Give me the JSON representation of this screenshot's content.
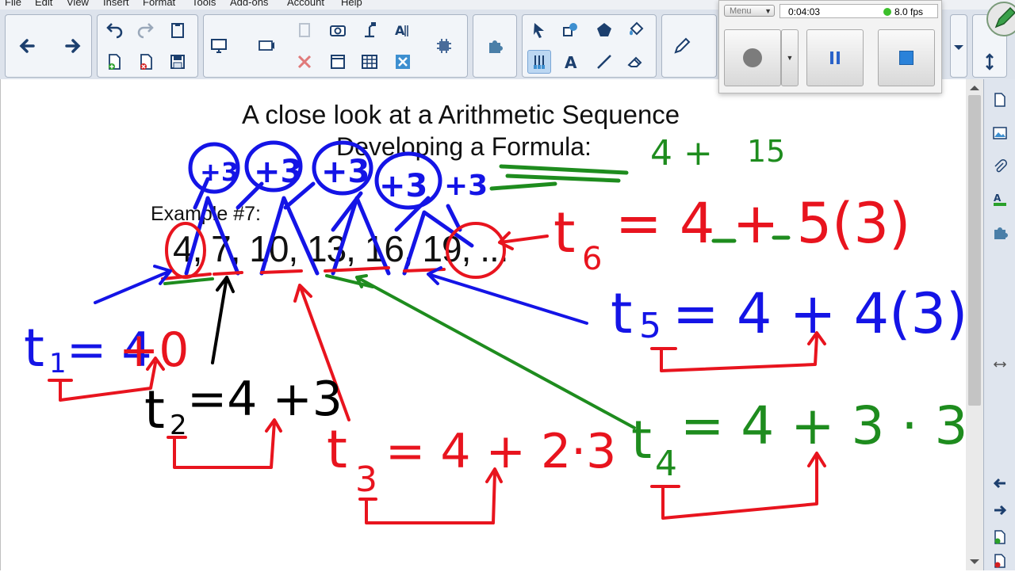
{
  "menubar": {
    "items": [
      "File",
      "Edit",
      "View",
      "Insert",
      "Format",
      "Tools",
      "Add-ons",
      "Account",
      "Help"
    ]
  },
  "toolbar": {
    "icons": [
      "back-arrow-icon",
      "forward-arrow-icon",
      "undo-icon",
      "redo-icon",
      "paste-icon",
      "new-page-icon",
      "delete-page-icon",
      "save-icon",
      "screen-display-icon",
      "screen-shade-icon",
      "clipboard-icon",
      "delete-icon",
      "camera-icon",
      "page-screen-icon",
      "document-camera-icon",
      "table-icon",
      "spell-icon",
      "clear-icon",
      "hardware-icon",
      "add-on-icon",
      "select-arrow-icon",
      "shapes-icon",
      "polygon-icon",
      "fill-icon",
      "pen-tool-icon",
      "text-icon",
      "line-icon",
      "eraser-icon",
      "pen-icon"
    ]
  },
  "recorder": {
    "menu_label": "Menu",
    "elapsed_time": "0:04:03",
    "fps": "8.0 fps",
    "status_color": "#3bbf2a"
  },
  "board": {
    "title_line1": "A close look at a Arithmetic Sequence",
    "title_line2": "Developing a Formula:",
    "example_label": "Example #7:",
    "sequence": "4, 7, 10, 13, 16, 19, ...",
    "handwriting": {
      "top_green": "4 + 15",
      "t1": "t1 = 4 + 0",
      "t2": "t2 = 4 + 3",
      "t3": "t3 = 4 + 2·3",
      "t4": "t4 = 4 + 3·3",
      "t5": "t5 = 4 + 4(3)",
      "t6": "t6 = 4 + 5(3)",
      "differences": [
        "+3",
        "+3",
        "+3",
        "+3",
        "+3"
      ]
    }
  },
  "colors": {
    "ink_blue": "#1414e6",
    "ink_red": "#e8141e",
    "ink_green": "#1e8c1e",
    "ink_black": "#000000",
    "toolbar_bg": "#dde3ec"
  }
}
